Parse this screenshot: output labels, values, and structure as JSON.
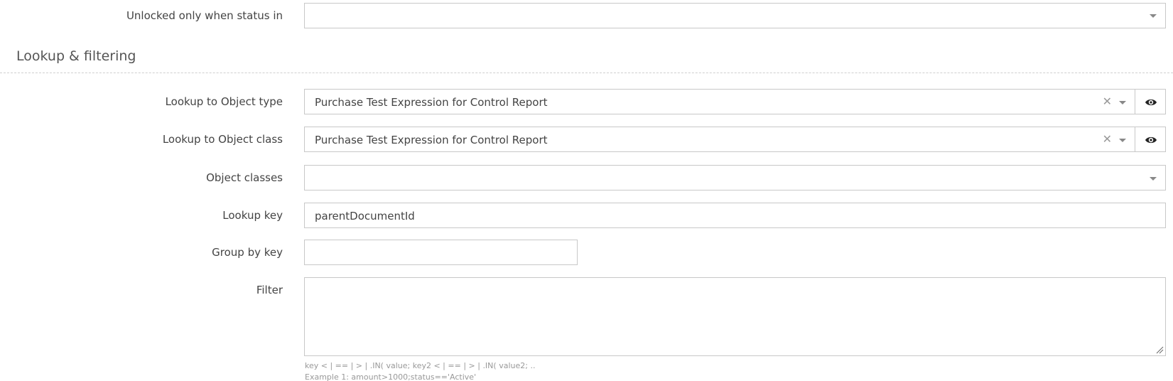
{
  "fields": {
    "unlocked_status": {
      "label": "Unlocked only when status in",
      "value": ""
    },
    "lookup_object_type": {
      "label": "Lookup to Object type",
      "value": "Purchase Test Expression for Control Report"
    },
    "lookup_object_class": {
      "label": "Lookup to Object class",
      "value": "Purchase Test Expression for Control Report"
    },
    "object_classes": {
      "label": "Object classes",
      "value": ""
    },
    "lookup_key": {
      "label": "Lookup key",
      "value": "parentDocumentId"
    },
    "group_by_key": {
      "label": "Group by key",
      "value": ""
    },
    "filter": {
      "label": "Filter",
      "value": ""
    }
  },
  "section": {
    "title": "Lookup & filtering"
  },
  "filter_hints": [
    "key < | == | > | .IN( value; key2 < | == | > | .IN( value2; ..",
    "Example 1: amount>1000;status=='Active'"
  ],
  "icons": {
    "clear": "close-icon",
    "dropdown": "chevron-down-icon",
    "view": "eye-icon"
  }
}
